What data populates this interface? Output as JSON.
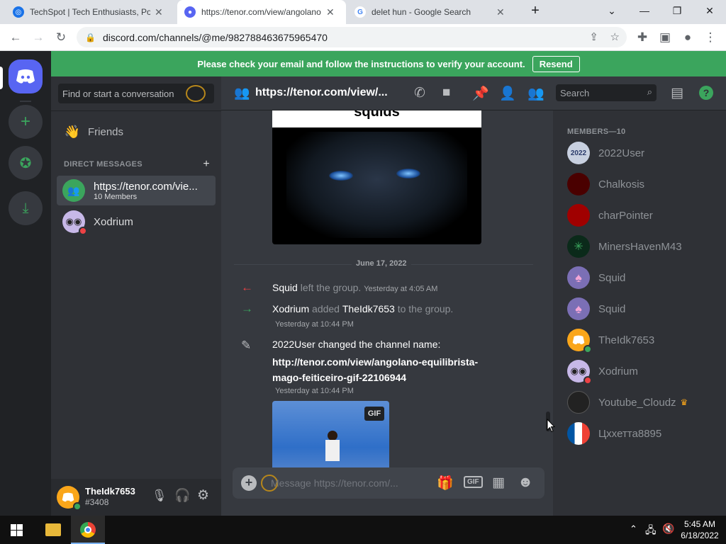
{
  "browser": {
    "tabs": [
      {
        "title": "TechSpot | Tech Enthusiasts, Pow",
        "fav_color": "#1a73e8"
      },
      {
        "title": "https://tenor.com/view/angolano",
        "fav_color": "#5865f2"
      },
      {
        "title": "delet hun - Google Search",
        "fav_color": "#ffffff"
      }
    ],
    "url": "discord.com/channels/@me/982788463675965470"
  },
  "banner": {
    "text": "Please check your email and follow the instructions to verify your account.",
    "button": "Resend"
  },
  "sidebar": {
    "search_placeholder": "Find or start a conversation",
    "friends_label": "Friends",
    "dm_header": "DIRECT MESSAGES",
    "dms": [
      {
        "name": "https://tenor.com/vie...",
        "sub": "10 Members"
      },
      {
        "name": "Xodrium"
      }
    ]
  },
  "user": {
    "name": "TheIdk7653",
    "tag": "#3408"
  },
  "channel": {
    "title": "https://tenor.com/view/...",
    "search_placeholder": "Search"
  },
  "chat": {
    "gif_caption": "squids",
    "date_divider": "June 17, 2022",
    "events": [
      {
        "actor": "Squid",
        "action": "left the group.",
        "time": "Yesterday at 4:05 AM"
      },
      {
        "actor": "Xodrium",
        "action": "added",
        "target": "TheIdk7653",
        "action2": "to the group.",
        "time": "Yesterday at 10:44 PM"
      },
      {
        "actor": "2022User",
        "action": "changed the channel name:",
        "link": "http://tenor.com/view/angolano-equilibrista-mago-feiticeiro-gif-22106944",
        "link_line1": "http://tenor.com/view/angolano-equilibrista-",
        "link_line2": "mago-feiticeiro-gif-22106944",
        "time": "Yesterday at 10:44 PM"
      }
    ],
    "gif_badge": "GIF",
    "message_placeholder": "Message https://tenor.com/..."
  },
  "members": {
    "header": "MEMBERS—10",
    "list": [
      {
        "name": "2022User",
        "color": "#c8d0e0"
      },
      {
        "name": "Chalkosis",
        "color": "#4a0000"
      },
      {
        "name": "charPointer",
        "color": "#a00000"
      },
      {
        "name": "MinersHavenM43",
        "color": "#0b2a1a"
      },
      {
        "name": "Squid",
        "color": "#7b6fb5"
      },
      {
        "name": "Squid",
        "color": "#7b6fb5"
      },
      {
        "name": "TheIdk7653",
        "color": "#faa61a"
      },
      {
        "name": "Xodrium",
        "color": "#c7b8e8"
      },
      {
        "name": "Youtube_Cloudz",
        "color": "#222222"
      },
      {
        "name": "Цхxетта8895",
        "color": "#0055a4"
      }
    ]
  },
  "taskbar": {
    "time": "5:45 AM",
    "date": "6/18/2022"
  }
}
